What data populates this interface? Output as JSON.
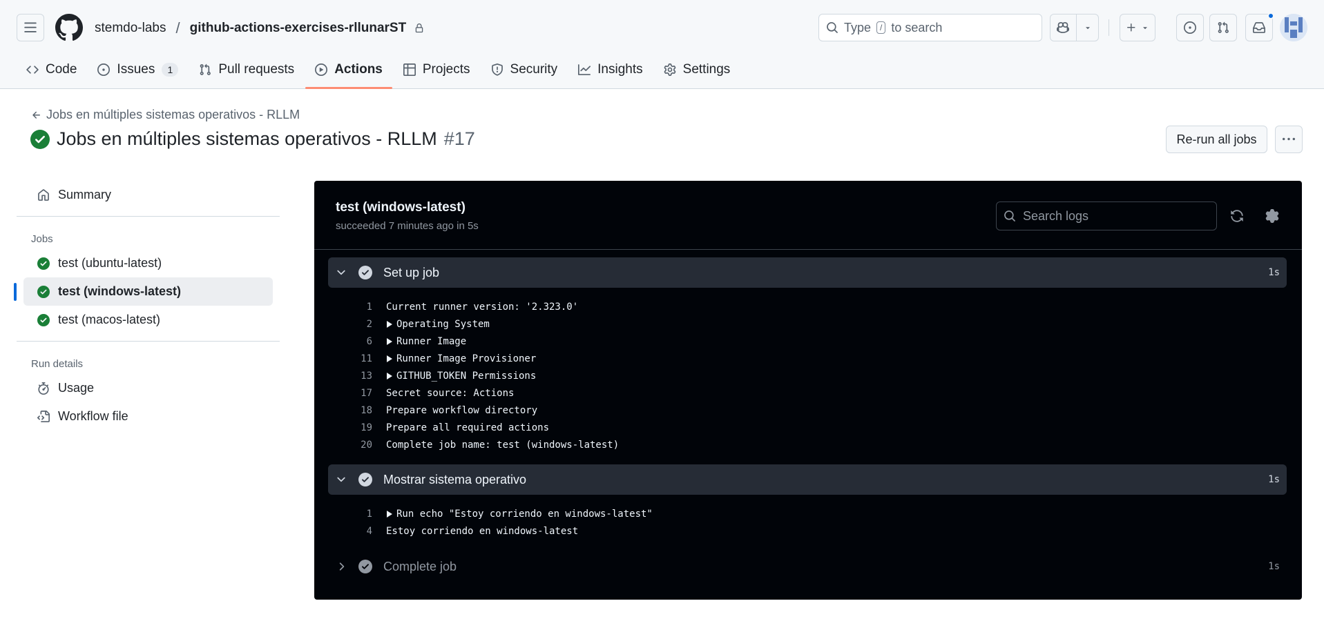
{
  "header": {
    "owner": "stemdo-labs",
    "separator": "/",
    "repo": "github-actions-exercises-rllunarST",
    "search_prefix": "Type",
    "search_key": "/",
    "search_suffix": "to search"
  },
  "nav": {
    "tabs": [
      {
        "label": "Code",
        "icon": "code-icon"
      },
      {
        "label": "Issues",
        "icon": "issue-icon",
        "count": "1"
      },
      {
        "label": "Pull requests",
        "icon": "pull-request-icon"
      },
      {
        "label": "Actions",
        "icon": "play-icon",
        "active": true
      },
      {
        "label": "Projects",
        "icon": "table-icon"
      },
      {
        "label": "Security",
        "icon": "shield-icon"
      },
      {
        "label": "Insights",
        "icon": "graph-icon"
      },
      {
        "label": "Settings",
        "icon": "gear-icon"
      }
    ]
  },
  "run": {
    "back_label": "Jobs en múltiples sistemas operativos - RLLM",
    "title": "Jobs en múltiples sistemas operativos - RLLM",
    "number": "#17",
    "rerun_label": "Re-run all jobs"
  },
  "sidebar": {
    "summary_label": "Summary",
    "jobs_heading": "Jobs",
    "jobs": [
      {
        "label": "test (ubuntu-latest)",
        "status": "success"
      },
      {
        "label": "test (windows-latest)",
        "status": "success",
        "selected": true
      },
      {
        "label": "test (macos-latest)",
        "status": "success"
      }
    ],
    "run_details_heading": "Run details",
    "usage_label": "Usage",
    "workflow_file_label": "Workflow file"
  },
  "log": {
    "job_title": "test (windows-latest)",
    "job_status": "succeeded 7 minutes ago in 5s",
    "search_placeholder": "Search logs",
    "steps": [
      {
        "name": "Set up job",
        "duration": "1s",
        "expanded": true,
        "lines": [
          {
            "n": "1",
            "text": "Current runner version: '2.323.0'",
            "group": false
          },
          {
            "n": "2",
            "text": "Operating System",
            "group": true
          },
          {
            "n": "6",
            "text": "Runner Image",
            "group": true
          },
          {
            "n": "11",
            "text": "Runner Image Provisioner",
            "group": true
          },
          {
            "n": "13",
            "text": "GITHUB_TOKEN Permissions",
            "group": true
          },
          {
            "n": "17",
            "text": "Secret source: Actions",
            "group": false
          },
          {
            "n": "18",
            "text": "Prepare workflow directory",
            "group": false
          },
          {
            "n": "19",
            "text": "Prepare all required actions",
            "group": false
          },
          {
            "n": "20",
            "text": "Complete job name: test (windows-latest)",
            "group": false
          }
        ]
      },
      {
        "name": "Mostrar sistema operativo",
        "duration": "1s",
        "expanded": true,
        "lines": [
          {
            "n": "1",
            "text": "Run echo \"Estoy corriendo en windows-latest\"",
            "group": true
          },
          {
            "n": "4",
            "text": "Estoy corriendo en windows-latest",
            "group": false
          }
        ]
      },
      {
        "name": "Complete job",
        "duration": "1s",
        "expanded": false,
        "lines": []
      }
    ]
  },
  "colors": {
    "success": "#1a7f37",
    "accent": "#0969da",
    "tab_underline": "#fd8c73",
    "log_bg": "#010409"
  }
}
